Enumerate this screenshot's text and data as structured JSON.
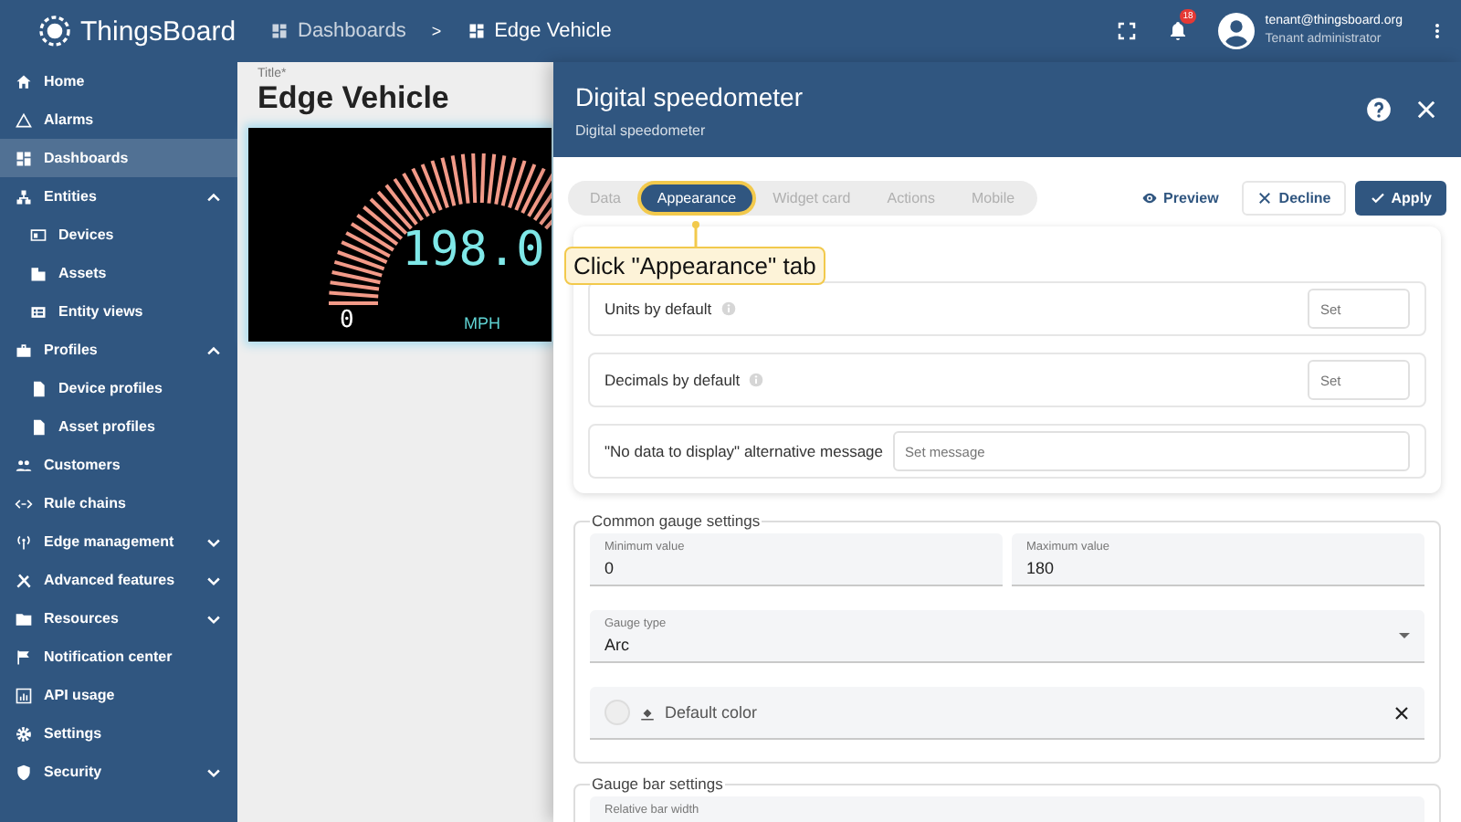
{
  "header": {
    "brand": "ThingsBoard",
    "breadcrumbs": [
      {
        "label": "Dashboards"
      },
      {
        "label": "Edge Vehicle"
      }
    ],
    "separator": ">",
    "notifications": "18",
    "user": {
      "email": "tenant@thingsboard.org",
      "role": "Tenant administrator"
    }
  },
  "sidebar": {
    "items": [
      {
        "label": "Home",
        "selected": false
      },
      {
        "label": "Alarms",
        "selected": false
      },
      {
        "label": "Dashboards",
        "selected": true
      },
      {
        "label": "Entities",
        "selected": false,
        "expanded": true,
        "children": [
          {
            "label": "Devices",
            "selected": false
          },
          {
            "label": "Assets",
            "selected": false
          },
          {
            "label": "Entity views",
            "selected": false
          }
        ]
      },
      {
        "label": "Profiles",
        "selected": false,
        "expanded": true,
        "children": [
          {
            "label": "Device profiles",
            "selected": false
          },
          {
            "label": "Asset profiles",
            "selected": false
          }
        ]
      },
      {
        "label": "Customers",
        "selected": false
      },
      {
        "label": "Rule chains",
        "selected": false
      },
      {
        "label": "Edge management",
        "selected": false,
        "expanded": false
      },
      {
        "label": "Advanced features",
        "selected": false,
        "expanded": false
      },
      {
        "label": "Resources",
        "selected": false,
        "expanded": false
      },
      {
        "label": "Notification center",
        "selected": false
      },
      {
        "label": "API usage",
        "selected": false
      },
      {
        "label": "Settings",
        "selected": false
      },
      {
        "label": "Security",
        "selected": false,
        "expanded": false
      }
    ]
  },
  "dashboard": {
    "title_label": "Title*",
    "title": "Edge Vehicle",
    "widget": {
      "value": "198.0",
      "min_label": "0",
      "units": "MPH"
    }
  },
  "panel": {
    "title": "Digital speedometer",
    "subtitle": "Digital speedometer",
    "tabs": [
      {
        "label": "Data",
        "selected": false
      },
      {
        "label": "Appearance",
        "selected": true
      },
      {
        "label": "Widget card",
        "selected": false
      },
      {
        "label": "Actions",
        "selected": false
      },
      {
        "label": "Mobile",
        "selected": false
      }
    ],
    "actions": [
      {
        "kind": "preview",
        "label": "Preview"
      },
      {
        "kind": "decline",
        "label": "Decline"
      },
      {
        "kind": "apply",
        "label": "Apply"
      }
    ],
    "callout": "Click \"Appearance\" tab",
    "settings": [
      {
        "kind": "unit",
        "label": "Units by default",
        "placeholder": "Set"
      },
      {
        "kind": "number",
        "label": "Decimals by default",
        "placeholder": "Set"
      },
      {
        "kind": "text",
        "label": "\"No data to display\" alternative message",
        "placeholder": "Set message"
      }
    ],
    "sections": [
      {
        "title": "Common gauge settings",
        "rows": [
          {
            "fields": [
              {
                "kind": "input",
                "label": "Minimum value",
                "value": "0"
              },
              {
                "kind": "input",
                "label": "Maximum value",
                "value": "180"
              }
            ]
          },
          {
            "fields": [
              {
                "kind": "select",
                "label": "Gauge type",
                "value": "Arc"
              }
            ]
          },
          {
            "fields": [
              {
                "kind": "color",
                "label": "Default color"
              }
            ]
          }
        ]
      },
      {
        "title": "Gauge bar settings",
        "rows": [
          {
            "fields": [
              {
                "kind": "input",
                "label": "Relative bar width"
              }
            ]
          }
        ]
      }
    ]
  }
}
